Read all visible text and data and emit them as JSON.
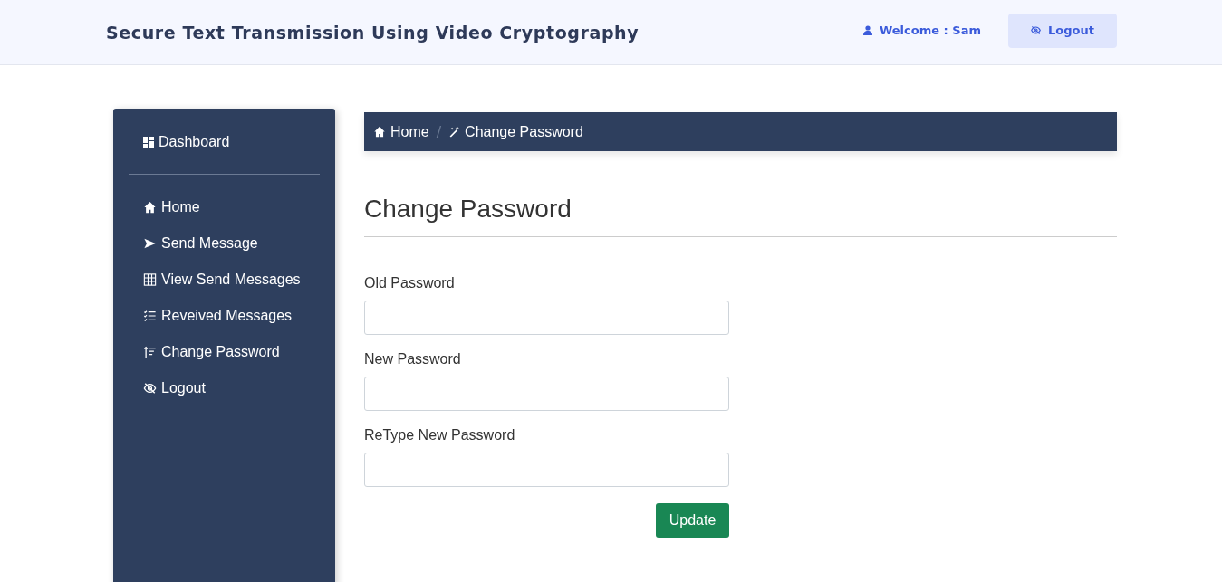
{
  "header": {
    "title": "Secure Text Transmission Using Video Cryptography",
    "welcome": "Welcome : Sam",
    "logout": "Logout"
  },
  "sidebar": {
    "dashboard": "Dashboard",
    "items": [
      {
        "label": "Home"
      },
      {
        "label": "Send Message"
      },
      {
        "label": "View Send Messages"
      },
      {
        "label": "Reveived Messages"
      },
      {
        "label": "Change Password"
      },
      {
        "label": "Logout"
      }
    ]
  },
  "breadcrumb": {
    "home": "Home",
    "separator": "/",
    "current": "Change Password"
  },
  "page_title": "Change Password",
  "fields": [
    {
      "label": "Old Password"
    },
    {
      "label": "New Password"
    },
    {
      "label": "ReType New Password"
    }
  ],
  "submit": "Update"
}
